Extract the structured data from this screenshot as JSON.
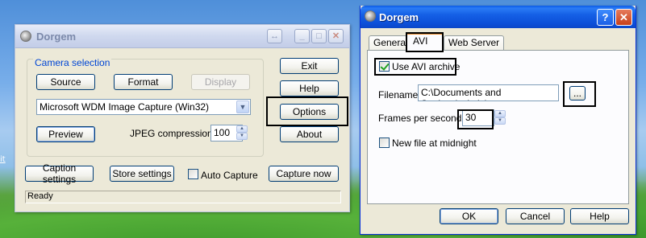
{
  "desktop": {
    "link_text": "it"
  },
  "window1": {
    "title": "Dorgem",
    "titlebar_icons": [
      "swap-arrows-icon",
      "minimize-icon",
      "maximize-icon",
      "close-icon"
    ],
    "titlebar_glyphs": {
      "swap": "↔",
      "minimize": "_",
      "maximize": "□",
      "close": "✕"
    },
    "camera_group": "Camera selection",
    "source_button": "Source",
    "format_button": "Format",
    "display_button": "Display",
    "camera_select": {
      "value": "Microsoft WDM Image Capture (Win32)",
      "arrow": "▼"
    },
    "preview_button": "Preview",
    "jpeg_label": "JPEG compression:",
    "jpeg_value": "100",
    "side_buttons": {
      "exit": "Exit",
      "help": "Help",
      "options": "Options",
      "about": "About"
    },
    "caption_settings": "Caption settings",
    "store_settings": "Store settings",
    "auto_capture_label": "Auto Capture",
    "auto_capture_checked": false,
    "capture_now": "Capture now",
    "status": "Ready"
  },
  "window2": {
    "title": "Dorgem",
    "caption_glyphs": {
      "help": "?",
      "close": "✕"
    },
    "tabs": [
      {
        "label": "General",
        "active": false
      },
      {
        "label": "AVI",
        "active": true
      },
      {
        "label": "Web Server",
        "active": false
      }
    ],
    "use_avi_label": "Use AVI archive",
    "use_avi_checked": true,
    "filename_label": "Filename:",
    "filename_value": "C:\\Documents and Settings\\admin\\",
    "browse_button": "...",
    "fps_label": "Frames per second",
    "fps_value": "30",
    "new_file_label": "New file at midnight",
    "new_file_checked": false,
    "ok_button": "OK",
    "cancel_button": "Cancel",
    "help_button": "Help"
  },
  "colors": {
    "highlight_border": "#000000",
    "active_titlebar": "#0c4fd8",
    "group_label": "#0046d5",
    "tab_accent": "#e68b2c"
  }
}
